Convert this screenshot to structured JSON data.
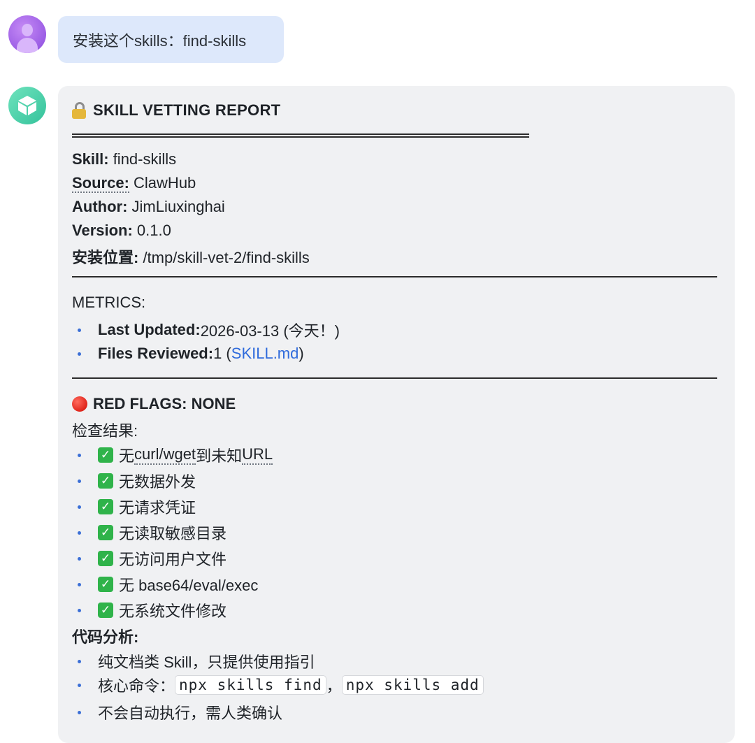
{
  "user_message": {
    "text": "安装这个skills：find-skills"
  },
  "report": {
    "title": "SKILL VETTING REPORT",
    "title_icon": "lock-icon",
    "meta": [
      {
        "key": "Skill:",
        "value": " find-skills"
      },
      {
        "key": "Source:",
        "value": " ClawHub"
      },
      {
        "key": "Author:",
        "value": " JimLiuxinghai"
      },
      {
        "key": "Version:",
        "value": " 0.1.0"
      },
      {
        "key": "安装位置:",
        "value": " /tmp/skill-vet-2/find-skills"
      }
    ],
    "metrics_heading": "METRICS:",
    "metrics": {
      "last_updated_key": "Last Updated:",
      "last_updated_value": " 2026-03-13 (今天！)",
      "files_reviewed_key": "Files Reviewed:",
      "files_reviewed_value": " 1 (",
      "files_reviewed_link": "SKILL.md",
      "files_reviewed_close": ")"
    },
    "red_flags": {
      "icon": "red-circle-icon",
      "prefix": "RED FLAGS: ",
      "value": "NONE"
    },
    "check_results_heading": "检查结果:",
    "checks": {
      "c1_a": "无 ",
      "c1_b": "curl/wget",
      "c1_c": " 到未知",
      "c1_d": "URL",
      "c2": "无数据外发",
      "c3": "无请求凭证",
      "c4": "无读取敏感目录",
      "c5": "无访问用户文件",
      "c6": "无 base64/eval/exec",
      "c7": "无系统文件修改"
    },
    "check_icon": "check-mark-icon",
    "code_analysis_heading": "代码分析:",
    "analysis": {
      "a1": "纯文档类 Skill，只提供使用指引",
      "a2_prefix": "核心命令：",
      "a2_cmd1": "npx skills find",
      "a2_sep": "，",
      "a2_cmd2": "npx skills add",
      "a3": "不会自动执行，需人类确认"
    }
  },
  "colors": {
    "user_bubble": "#dde8fb",
    "bot_card": "#f0f1f3",
    "link": "#2f6bdc",
    "bullet": "#3b6fd6",
    "check_green": "#2fb34a",
    "red_flag": "#e0251b"
  }
}
